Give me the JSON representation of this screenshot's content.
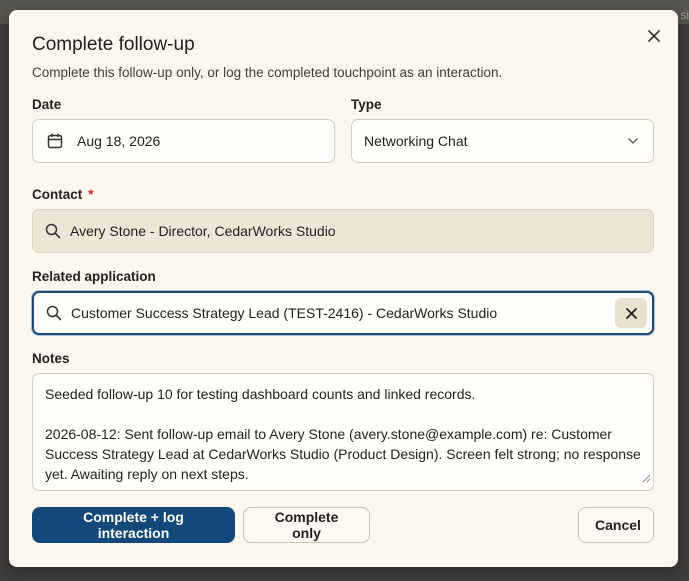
{
  "backdrop": {
    "partial_text": "si"
  },
  "dialog": {
    "title": "Complete follow-up",
    "subtitle": "Complete this follow-up only, or log the completed touchpoint as an interaction.",
    "close_icon": "close-icon"
  },
  "date_field": {
    "label": "Date",
    "value": "Aug 18, 2026",
    "icon": "calendar-icon"
  },
  "type_field": {
    "label": "Type",
    "value": "Networking Chat",
    "icon": "chevron-down-icon"
  },
  "contact_field": {
    "label": "Contact",
    "required_marker": "*",
    "value": "Avery Stone - Director, CedarWorks Studio",
    "icon": "search-icon"
  },
  "related_field": {
    "label": "Related application",
    "value": "Customer Success Strategy Lead (TEST-2416) - CedarWorks Studio",
    "icon": "search-icon",
    "clear_icon": "close-icon"
  },
  "notes_field": {
    "label": "Notes",
    "paragraphs": [
      "Seeded follow-up 10 for testing dashboard counts and linked records.",
      "2026-08-12: Sent follow-up email to Avery Stone (avery.stone@example.com) re: Customer Success Strategy Lead at CedarWorks Studio (Product Design). Screen felt strong; no response yet. Awaiting reply on next steps."
    ]
  },
  "actions": {
    "primary_label": "Complete + log interaction",
    "secondary_label": "Complete only",
    "cancel_label": "Cancel"
  },
  "colors": {
    "dialog_bg": "#fbf7ee",
    "primary_button": "#13497a",
    "focus_border": "#1f4b79",
    "required": "#c62828",
    "readonly_field_bg": "#ede6d6"
  }
}
